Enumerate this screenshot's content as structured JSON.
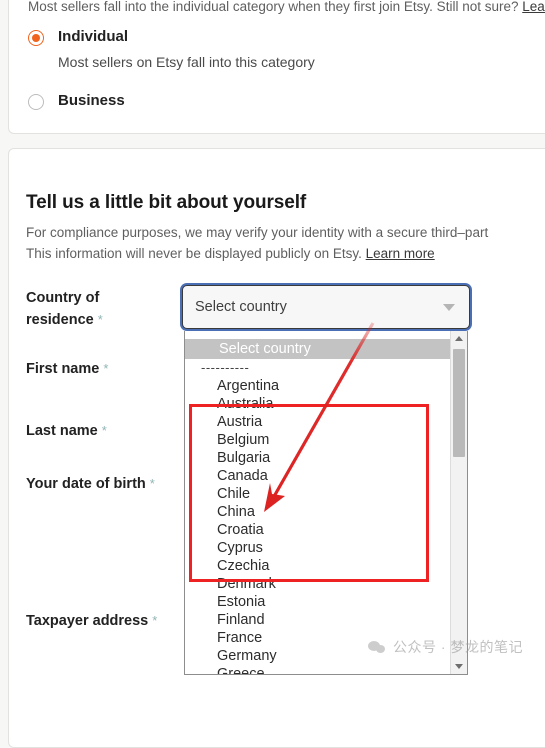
{
  "seller_type": {
    "intro": "Most sellers fall into the individual category when they first join Etsy. Still not sure? ",
    "intro_link": "Learn m",
    "options": [
      {
        "title": "Individual",
        "subtitle": "Most sellers on Etsy fall into this category",
        "selected": true
      },
      {
        "title": "Business",
        "subtitle": "",
        "selected": false
      }
    ]
  },
  "about_you": {
    "title": "Tell us a little bit about yourself",
    "desc_line1": "For compliance purposes, we may verify your identity with a secure third–part",
    "desc_line2": "This information will never be displayed publicly on Etsy. ",
    "desc_link": "Learn more",
    "fields": {
      "country": {
        "label": "Country of residence",
        "required": "*"
      },
      "first_name": {
        "label": "First name",
        "required": "*"
      },
      "last_name": {
        "label": "Last name",
        "required": "*"
      },
      "dob": {
        "label": "Your date of birth",
        "required": "*"
      },
      "taxpayer_address": {
        "label": "Taxpayer address",
        "required": "*"
      }
    }
  },
  "country_select": {
    "value": "Select country",
    "caret": "chevron-down-icon",
    "options": [
      "Select country",
      "----------",
      "Argentina",
      "Australia",
      "Austria",
      "Belgium",
      "Bulgaria",
      "Canada",
      "Chile",
      "China",
      "Croatia",
      "Cyprus",
      "Czechia",
      "Denmark",
      "Estonia",
      "Finland",
      "France",
      "Germany",
      "Greece"
    ],
    "highlighted_index": 0,
    "scroll_up_icon": "scroll-up-arrow",
    "scroll_down_icon": "scroll-down-arrow"
  },
  "annotations": {
    "box_color": "#ee2222",
    "arrow_color": "#dd2222",
    "arrow_target": "China"
  },
  "watermark": {
    "icon": "wechat-icon",
    "text": "公众号 · 梦龙的笔记"
  },
  "colors": {
    "accent_orange": "#f1641e",
    "focus_blue": "#4a6fb5",
    "annotation_red": "#ee2222",
    "required_star": "#8fb5b5"
  }
}
